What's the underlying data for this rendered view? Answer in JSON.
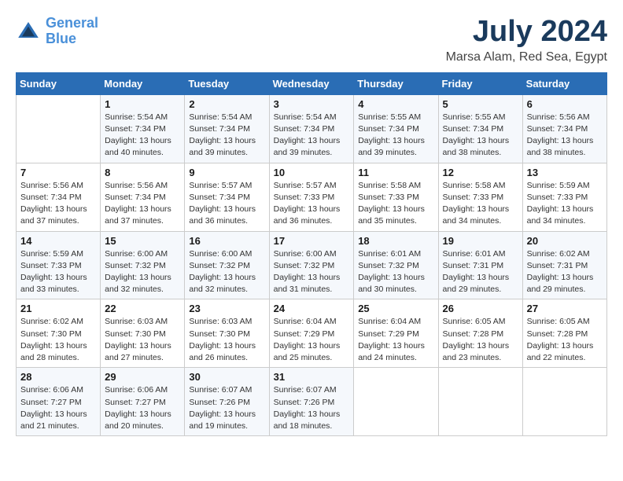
{
  "header": {
    "logo_line1": "General",
    "logo_line2": "Blue",
    "month": "July 2024",
    "location": "Marsa Alam, Red Sea, Egypt"
  },
  "days_of_week": [
    "Sunday",
    "Monday",
    "Tuesday",
    "Wednesday",
    "Thursday",
    "Friday",
    "Saturday"
  ],
  "weeks": [
    [
      {
        "num": "",
        "info": ""
      },
      {
        "num": "1",
        "info": "Sunrise: 5:54 AM\nSunset: 7:34 PM\nDaylight: 13 hours\nand 40 minutes."
      },
      {
        "num": "2",
        "info": "Sunrise: 5:54 AM\nSunset: 7:34 PM\nDaylight: 13 hours\nand 39 minutes."
      },
      {
        "num": "3",
        "info": "Sunrise: 5:54 AM\nSunset: 7:34 PM\nDaylight: 13 hours\nand 39 minutes."
      },
      {
        "num": "4",
        "info": "Sunrise: 5:55 AM\nSunset: 7:34 PM\nDaylight: 13 hours\nand 39 minutes."
      },
      {
        "num": "5",
        "info": "Sunrise: 5:55 AM\nSunset: 7:34 PM\nDaylight: 13 hours\nand 38 minutes."
      },
      {
        "num": "6",
        "info": "Sunrise: 5:56 AM\nSunset: 7:34 PM\nDaylight: 13 hours\nand 38 minutes."
      }
    ],
    [
      {
        "num": "7",
        "info": "Sunrise: 5:56 AM\nSunset: 7:34 PM\nDaylight: 13 hours\nand 37 minutes."
      },
      {
        "num": "8",
        "info": "Sunrise: 5:56 AM\nSunset: 7:34 PM\nDaylight: 13 hours\nand 37 minutes."
      },
      {
        "num": "9",
        "info": "Sunrise: 5:57 AM\nSunset: 7:34 PM\nDaylight: 13 hours\nand 36 minutes."
      },
      {
        "num": "10",
        "info": "Sunrise: 5:57 AM\nSunset: 7:33 PM\nDaylight: 13 hours\nand 36 minutes."
      },
      {
        "num": "11",
        "info": "Sunrise: 5:58 AM\nSunset: 7:33 PM\nDaylight: 13 hours\nand 35 minutes."
      },
      {
        "num": "12",
        "info": "Sunrise: 5:58 AM\nSunset: 7:33 PM\nDaylight: 13 hours\nand 34 minutes."
      },
      {
        "num": "13",
        "info": "Sunrise: 5:59 AM\nSunset: 7:33 PM\nDaylight: 13 hours\nand 34 minutes."
      }
    ],
    [
      {
        "num": "14",
        "info": "Sunrise: 5:59 AM\nSunset: 7:33 PM\nDaylight: 13 hours\nand 33 minutes."
      },
      {
        "num": "15",
        "info": "Sunrise: 6:00 AM\nSunset: 7:32 PM\nDaylight: 13 hours\nand 32 minutes."
      },
      {
        "num": "16",
        "info": "Sunrise: 6:00 AM\nSunset: 7:32 PM\nDaylight: 13 hours\nand 32 minutes."
      },
      {
        "num": "17",
        "info": "Sunrise: 6:00 AM\nSunset: 7:32 PM\nDaylight: 13 hours\nand 31 minutes."
      },
      {
        "num": "18",
        "info": "Sunrise: 6:01 AM\nSunset: 7:32 PM\nDaylight: 13 hours\nand 30 minutes."
      },
      {
        "num": "19",
        "info": "Sunrise: 6:01 AM\nSunset: 7:31 PM\nDaylight: 13 hours\nand 29 minutes."
      },
      {
        "num": "20",
        "info": "Sunrise: 6:02 AM\nSunset: 7:31 PM\nDaylight: 13 hours\nand 29 minutes."
      }
    ],
    [
      {
        "num": "21",
        "info": "Sunrise: 6:02 AM\nSunset: 7:30 PM\nDaylight: 13 hours\nand 28 minutes."
      },
      {
        "num": "22",
        "info": "Sunrise: 6:03 AM\nSunset: 7:30 PM\nDaylight: 13 hours\nand 27 minutes."
      },
      {
        "num": "23",
        "info": "Sunrise: 6:03 AM\nSunset: 7:30 PM\nDaylight: 13 hours\nand 26 minutes."
      },
      {
        "num": "24",
        "info": "Sunrise: 6:04 AM\nSunset: 7:29 PM\nDaylight: 13 hours\nand 25 minutes."
      },
      {
        "num": "25",
        "info": "Sunrise: 6:04 AM\nSunset: 7:29 PM\nDaylight: 13 hours\nand 24 minutes."
      },
      {
        "num": "26",
        "info": "Sunrise: 6:05 AM\nSunset: 7:28 PM\nDaylight: 13 hours\nand 23 minutes."
      },
      {
        "num": "27",
        "info": "Sunrise: 6:05 AM\nSunset: 7:28 PM\nDaylight: 13 hours\nand 22 minutes."
      }
    ],
    [
      {
        "num": "28",
        "info": "Sunrise: 6:06 AM\nSunset: 7:27 PM\nDaylight: 13 hours\nand 21 minutes."
      },
      {
        "num": "29",
        "info": "Sunrise: 6:06 AM\nSunset: 7:27 PM\nDaylight: 13 hours\nand 20 minutes."
      },
      {
        "num": "30",
        "info": "Sunrise: 6:07 AM\nSunset: 7:26 PM\nDaylight: 13 hours\nand 19 minutes."
      },
      {
        "num": "31",
        "info": "Sunrise: 6:07 AM\nSunset: 7:26 PM\nDaylight: 13 hours\nand 18 minutes."
      },
      {
        "num": "",
        "info": ""
      },
      {
        "num": "",
        "info": ""
      },
      {
        "num": "",
        "info": ""
      }
    ]
  ]
}
